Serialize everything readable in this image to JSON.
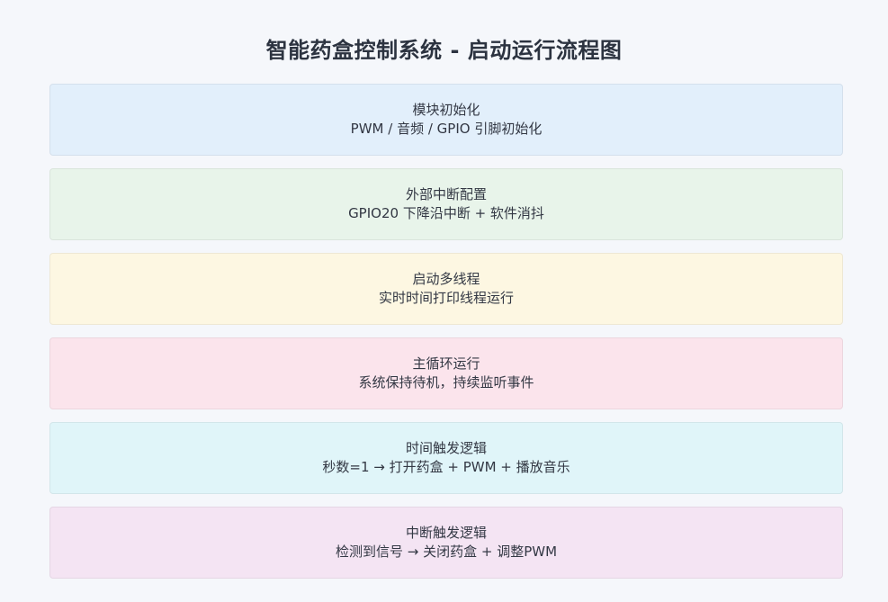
{
  "title": "智能药盒控制系统 - 启动运行流程图",
  "steps": [
    {
      "heading": "模块初始化",
      "detail": "PWM / 音频 / GPIO 引脚初始化",
      "color": "#e2effb"
    },
    {
      "heading": "外部中断配置",
      "detail": "GPIO20 下降沿中断 + 软件消抖",
      "color": "#e8f4ea"
    },
    {
      "heading": "启动多线程",
      "detail": "实时时间打印线程运行",
      "color": "#fdf7e2"
    },
    {
      "heading": "主循环运行",
      "detail": "系统保持待机，持续监听事件",
      "color": "#fbe4ec"
    },
    {
      "heading": "时间触发逻辑",
      "detail": "秒数=1 → 打开药盒 + PWM + 播放音乐",
      "color": "#e0f5f9"
    },
    {
      "heading": "中断触发逻辑",
      "detail": "检测到信号 → 关闭药盒 + 调整PWM",
      "color": "#f4e4f3"
    }
  ]
}
